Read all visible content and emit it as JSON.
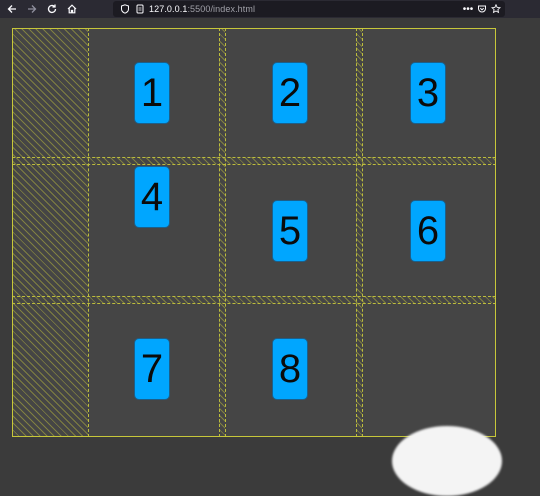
{
  "browser": {
    "url_host": "127.0.0.1",
    "url_rest": ":5500/index.html",
    "menu_glyph": "•••"
  },
  "colors": {
    "toolbar_bg": "#2b2a33",
    "page_bg": "#3b3b3b",
    "grid_bg": "#454545",
    "grid_line": "#c7c73a",
    "tile_bg": "#00a6ff"
  },
  "grid": {
    "tiles": [
      {
        "label": "1"
      },
      {
        "label": "2"
      },
      {
        "label": "3"
      },
      {
        "label": "4"
      },
      {
        "label": "5"
      },
      {
        "label": "6"
      },
      {
        "label": "7"
      },
      {
        "label": "8"
      }
    ]
  }
}
